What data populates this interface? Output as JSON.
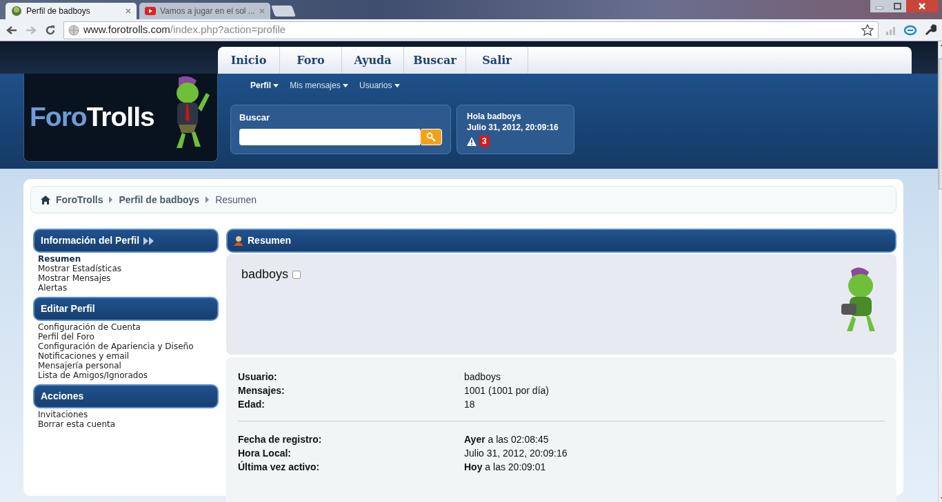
{
  "browser": {
    "tabs": [
      {
        "title": "Perfil de badboys",
        "selected": true
      },
      {
        "title": "Vamos a jugar en el sol ...",
        "selected": false
      }
    ],
    "url_host": "www.forotrolls.com",
    "url_path": "/index.php?action=profile"
  },
  "logo": [
    {
      "text": "Foro",
      "kind": "accent"
    },
    {
      "text": "Trolls",
      "kind": "plain"
    }
  ],
  "main_nav": [
    "Inicio",
    "Foro",
    "Ayuda",
    "Buscar",
    "Salir"
  ],
  "sub_nav": [
    {
      "label": "Perfil",
      "selected": true
    },
    {
      "label": "Mis mensajes",
      "selected": false
    },
    {
      "label": "Usuarios",
      "selected": false
    }
  ],
  "search": {
    "title": "Buscar"
  },
  "user_box": {
    "greeting": "Hola badboys",
    "time": "Julio 31, 2012, 20:09:16",
    "alerts": "3"
  },
  "breadcrumb": [
    "ForoTrolls",
    "Perfil de badboys",
    "Resumen"
  ],
  "sidebar": [
    {
      "title": "Información del Perfil",
      "items": [
        {
          "label": "Resumen",
          "selected": true
        },
        {
          "label": "Mostrar Estadísticas",
          "selected": false
        },
        {
          "label": "Mostrar Mensajes",
          "selected": false
        },
        {
          "label": "Alertas",
          "selected": false
        }
      ]
    },
    {
      "title": "Editar Perfil",
      "items": [
        {
          "label": "Configuración de Cuenta",
          "selected": false
        },
        {
          "label": "Perfil del Foro",
          "selected": false
        },
        {
          "label": "Configuración de Apariencia y Diseño",
          "selected": false
        },
        {
          "label": "Notificaciones y email",
          "selected": false
        },
        {
          "label": "Mensajería personal",
          "selected": false
        },
        {
          "label": "Lista de Amigos/Ignorados",
          "selected": false
        }
      ]
    },
    {
      "title": "Acciones",
      "items": [
        {
          "label": "Invitaciones",
          "selected": false
        },
        {
          "label": "Borrar esta cuenta",
          "selected": false
        }
      ]
    }
  ],
  "profile": {
    "title": "Resumen",
    "username": "badboys",
    "online": false,
    "groups": [
      [
        {
          "label": "Usuario:",
          "value": "badboys"
        },
        {
          "label": "Mensajes:",
          "value": "1001 (1001 por día)"
        },
        {
          "label": "Edad:",
          "value": "18"
        }
      ],
      [
        {
          "label": "Fecha de registro:",
          "value": "**Ayer** a las 02:08:45"
        },
        {
          "label": "Hora Local:",
          "value": "Julio 31, 2012, 20:09:16"
        },
        {
          "label": "Última vez activo:",
          "value": "**Hoy** a las 20:09:01"
        }
      ]
    ]
  }
}
